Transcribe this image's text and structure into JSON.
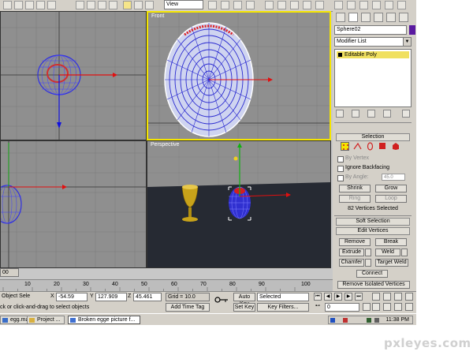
{
  "toolbar": {
    "view_select": "View"
  },
  "viewports": {
    "top_left_label": "",
    "front_label": "Front",
    "left_label": "",
    "perspective_label": "Perspective"
  },
  "command_panel": {
    "object_name": "Sphere02",
    "object_color": "#5a1aa0",
    "modifier_list": "Modifier List",
    "stack_item": "Editable Poly",
    "selection_rollout": "Selection",
    "by_vertex": "By Vertex",
    "ignore_backfacing": "Ignore Backfacing",
    "by_angle": "By Angle:",
    "by_angle_value": "45.0",
    "shrink": "Shrink",
    "grow": "Grow",
    "ring": "Ring",
    "loop": "Loop",
    "selected_count": "82 Vertices Selected",
    "soft_selection": "Soft Selection",
    "edit_vertices": "Edit Vertices",
    "remove": "Remove",
    "break": "Break",
    "extrude": "Extrude",
    "weld": "Weld",
    "chamfer": "Chamfer",
    "target_weld": "Target Weld",
    "connect": "Connect",
    "remove_isolated": "Remove Isolated Vertices"
  },
  "timeline": {
    "frame_slider": "00",
    "ticks": [
      "10",
      "20",
      "30",
      "40",
      "50",
      "60",
      "70",
      "80",
      "90",
      "100"
    ]
  },
  "status": {
    "selection": "Object Sele",
    "x_label": "X",
    "x_value": "-54.59",
    "y_label": "Y",
    "y_value": "127.909",
    "z_label": "Z",
    "z_value": "45.461",
    "grid": "Grid = 10.0",
    "auto_key": "Auto Key",
    "set_key": "Set Key",
    "key_select": "Selected",
    "key_filters": "Key Filters...",
    "frame_value": "0",
    "prompt": "ck or click-and-drag to select objects",
    "add_time_tag": "Add Time Tag"
  },
  "taskbar": {
    "items": [
      "egg.max",
      "Project ...",
      "Broken egge picture f..."
    ],
    "clock": "11:38 PM"
  },
  "watermark": "pxleyes.com"
}
